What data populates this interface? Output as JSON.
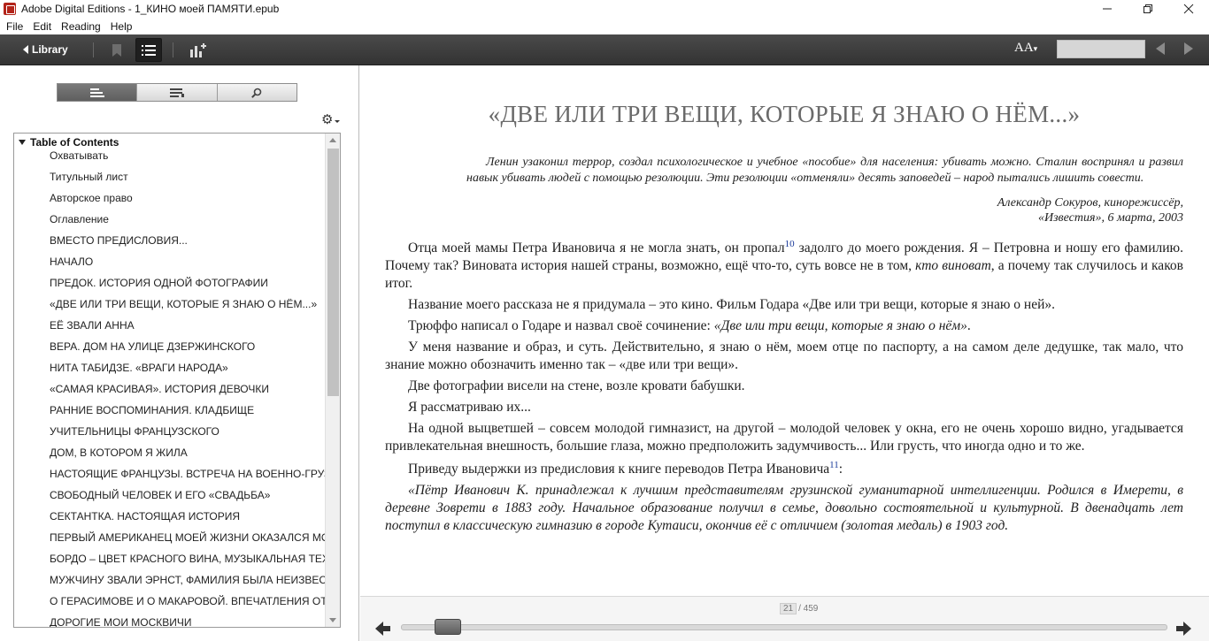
{
  "window": {
    "title": "Adobe Digital Editions - 1_КИНО моей ПАМЯТИ.epub",
    "minimize": "—",
    "maximize": "❐",
    "close": "✕"
  },
  "menu": [
    "File",
    "Edit",
    "Reading",
    "Help"
  ],
  "toolbar": {
    "library_label": "Library",
    "font_label": "AA"
  },
  "sidebar": {
    "toc_header": "Table of Contents",
    "items": [
      "Охватывать",
      "Титульный лист",
      "Авторское право",
      "Оглавление",
      "ВМЕСТО ПРЕДИСЛОВИЯ...",
      "НАЧАЛО",
      "ПРЕДОК. ИСТОРИЯ ОДНОЙ ФОТОГРАФИИ",
      "«ДВЕ ИЛИ ТРИ ВЕЩИ, КОТОРЫЕ Я ЗНАЮ О НЁМ...»",
      "ЕЁ ЗВАЛИ АННА",
      "ВЕРА. ДОМ НА УЛИЦЕ ДЗЕРЖИНСКОГО",
      "НИТА ТАБИДЗЕ. «ВРАГИ НАРОДА»",
      "«САМАЯ КРАСИВАЯ». ИСТОРИЯ ДЕВОЧКИ",
      "РАННИЕ ВОСПОМИНАНИЯ. КЛАДБИЩЕ",
      "УЧИТЕЛЬНИЦЫ ФРАНЦУЗСКОГО",
      "ДОМ, В КОТОРОМ Я ЖИЛА",
      "НАСТОЯЩИЕ ФРАНЦУЗЫ. ВСТРЕЧА НА ВОЕННО-ГРУЗИН",
      "СВОБОДНЫЙ ЧЕЛОВЕК И ЕГО «СВАДЬБА»",
      "СЕКТАНТКА. НАСТОЯЩАЯ ИСТОРИЯ",
      "ПЕРВЫЙ АМЕРИКАНЕЦ МОЕЙ ЖИЗНИ ОКАЗАЛСЯ МОС",
      "БОРДО – ЦВЕТ КРАСНОГО ВИНА, МУЗЫКАЛЬНАЯ ТЕХНИ",
      "МУЖЧИНУ ЗВАЛИ ЭРНСТ, ФАМИЛИЯ БЫЛА НЕИЗВЕСТН",
      "О ГЕРАСИМОВЕ И О МАКАРОВОЙ. ВПЕЧАТЛЕНИЯ ОТ О",
      "ДОРОГИЕ МОИ МОСКВИЧИ"
    ]
  },
  "content": {
    "title": "«ДВЕ ИЛИ ТРИ ВЕЩИ, КОТОРЫЕ Я ЗНАЮ О НЁМ...»",
    "epigraph": "Ленин узаконил террор, создал психологическое и учебное «пособие» для населения: убивать можно. Сталин воспринял и развил навык убивать людей с помощью резолюции. Эти резолюции «отменяли» десять заповедей – народ пытались лишить совести.",
    "attribution_line1": "Александр Сокуров, кинорежиссёр,",
    "attribution_line2": "«Известия», 6 марта, 2003",
    "p1_a": "Отца моей мамы Петра Ивановича я не могла знать, он пропал",
    "p1_fn": "10",
    "p1_b": " задолго до моего рождения. Я – Петровна и ношу его фамилию. Почему так? Виновата история нашей страны, возможно, ещё что-то, суть вовсе не в том, ",
    "p1_it": "кто виноват",
    "p1_c": ", а почему так случилось и каков итог.",
    "p2": "Название моего рассказа не я придумала – это кино. Фильм Годара «Две или три вещи, которые я знаю о ней».",
    "p3_a": "Трюффо написал о Годаре и назвал своё сочинение: ",
    "p3_it": "«Две или три вещи, которые я знаю о нём»",
    "p3_b": ".",
    "p4": "У меня название и образ, и суть. Действительно, я знаю о нём, моем отце по паспорту, а на самом деле дедушке, так мало, что знание можно обозначить именно так – «две или три вещи».",
    "p5": "Две фотографии висели на стене, возле кровати бабушки.",
    "p6": "Я рассматриваю их...",
    "p7": "На одной выцветшей – совсем молодой гимназист, на другой – молодой человек у окна, его не очень хорошо видно, угадывается привлекательная внешность, большие глаза, можно предположить задумчивость... Или грусть, что иногда одно и то же.",
    "p8_a": "Приведу выдержки из предисловия к книге переводов Петра Ивановича",
    "p8_fn": "11",
    "p8_b": ":",
    "p9": "«Пётр Иванович К. принадлежал к лучшим представителям грузинской гуманитарной интеллигенции. Родился в Имерети, в деревне Зоврети в 1883 году. Начальное образование получил в семье, довольно состоятельной и культурной. В двенадцать лет поступил в классическую гимназию в городе Кутаиси, окончив её с отличием (золотая медаль) в 1903 год."
  },
  "pager": {
    "current_page": "21",
    "total_pages": "/ 459",
    "progress_fraction": 0.046
  },
  "colors": {
    "toolbar_bg": "#3e3e3e",
    "footnote_link": "#1a3a9a",
    "title_gray": "#6a6a6a"
  }
}
